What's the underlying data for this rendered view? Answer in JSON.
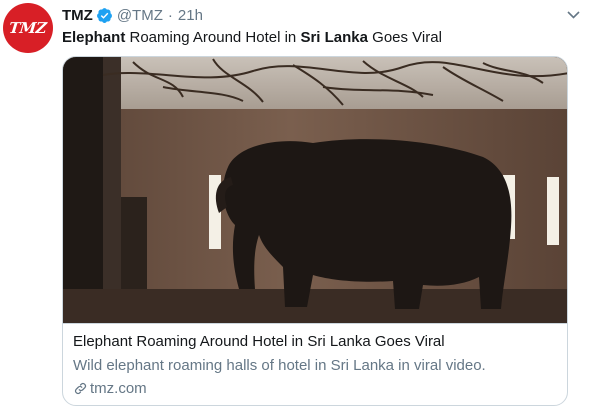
{
  "tweet": {
    "avatar_text": "TMZ",
    "display_name": "TMZ",
    "handle": "@TMZ",
    "separator": "·",
    "time": "21h",
    "text_parts": [
      {
        "text": "Elephant",
        "bold": true
      },
      {
        "text": " Roaming Around Hotel in ",
        "bold": false
      },
      {
        "text": "Sri Lanka",
        "bold": true
      },
      {
        "text": " Goes Viral",
        "bold": false
      }
    ]
  },
  "card": {
    "title": "Elephant Roaming Around Hotel in Sri Lanka Goes Viral",
    "description": "Wild elephant roaming halls of hotel in Sri Lanka in viral video.",
    "domain": "tmz.com"
  },
  "icons": {
    "verified": "verified-badge-icon",
    "caret": "chevron-down-icon",
    "link": "link-icon"
  },
  "colors": {
    "brand_red": "#d81f26",
    "verified_blue": "#1da1f2",
    "secondary_text": "#657786",
    "border": "#ccd6dd"
  }
}
